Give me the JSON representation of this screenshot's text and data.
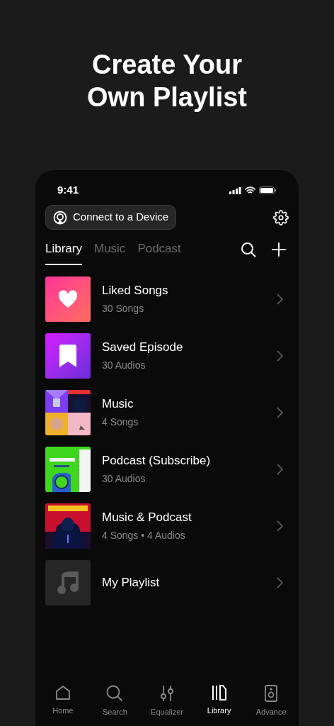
{
  "headline": "Create Your Own Playlist",
  "status_bar": {
    "time": "9:41"
  },
  "connect_button": {
    "label": "Connect to a Device"
  },
  "tabs": [
    {
      "label": "Library",
      "selected": true
    },
    {
      "label": "Music",
      "selected": false
    },
    {
      "label": "Podcast",
      "selected": false
    }
  ],
  "items": [
    {
      "kind": "liked",
      "title": "Liked Songs",
      "subtitle": "30 Songs"
    },
    {
      "kind": "saved",
      "title": "Saved Episode",
      "subtitle": "30 Audios"
    },
    {
      "kind": "collage",
      "title": "Music",
      "subtitle": "4 Songs"
    },
    {
      "kind": "podcast_cover",
      "title": "Podcast (Subscribe)",
      "subtitle": "30 Audios"
    },
    {
      "kind": "album_cover",
      "title": "Music & Podcast",
      "subtitle": "4 Songs • 4 Audios"
    },
    {
      "kind": "empty",
      "title": "My Playlist"
    }
  ],
  "nav": [
    {
      "kind": "home",
      "label": "Home",
      "selected": false
    },
    {
      "kind": "search",
      "label": "Search",
      "selected": false
    },
    {
      "kind": "equalizer",
      "label": "Equalizer",
      "selected": false
    },
    {
      "kind": "library",
      "label": "Library",
      "selected": true
    },
    {
      "kind": "speaker",
      "label": "Advance",
      "selected": false
    }
  ]
}
